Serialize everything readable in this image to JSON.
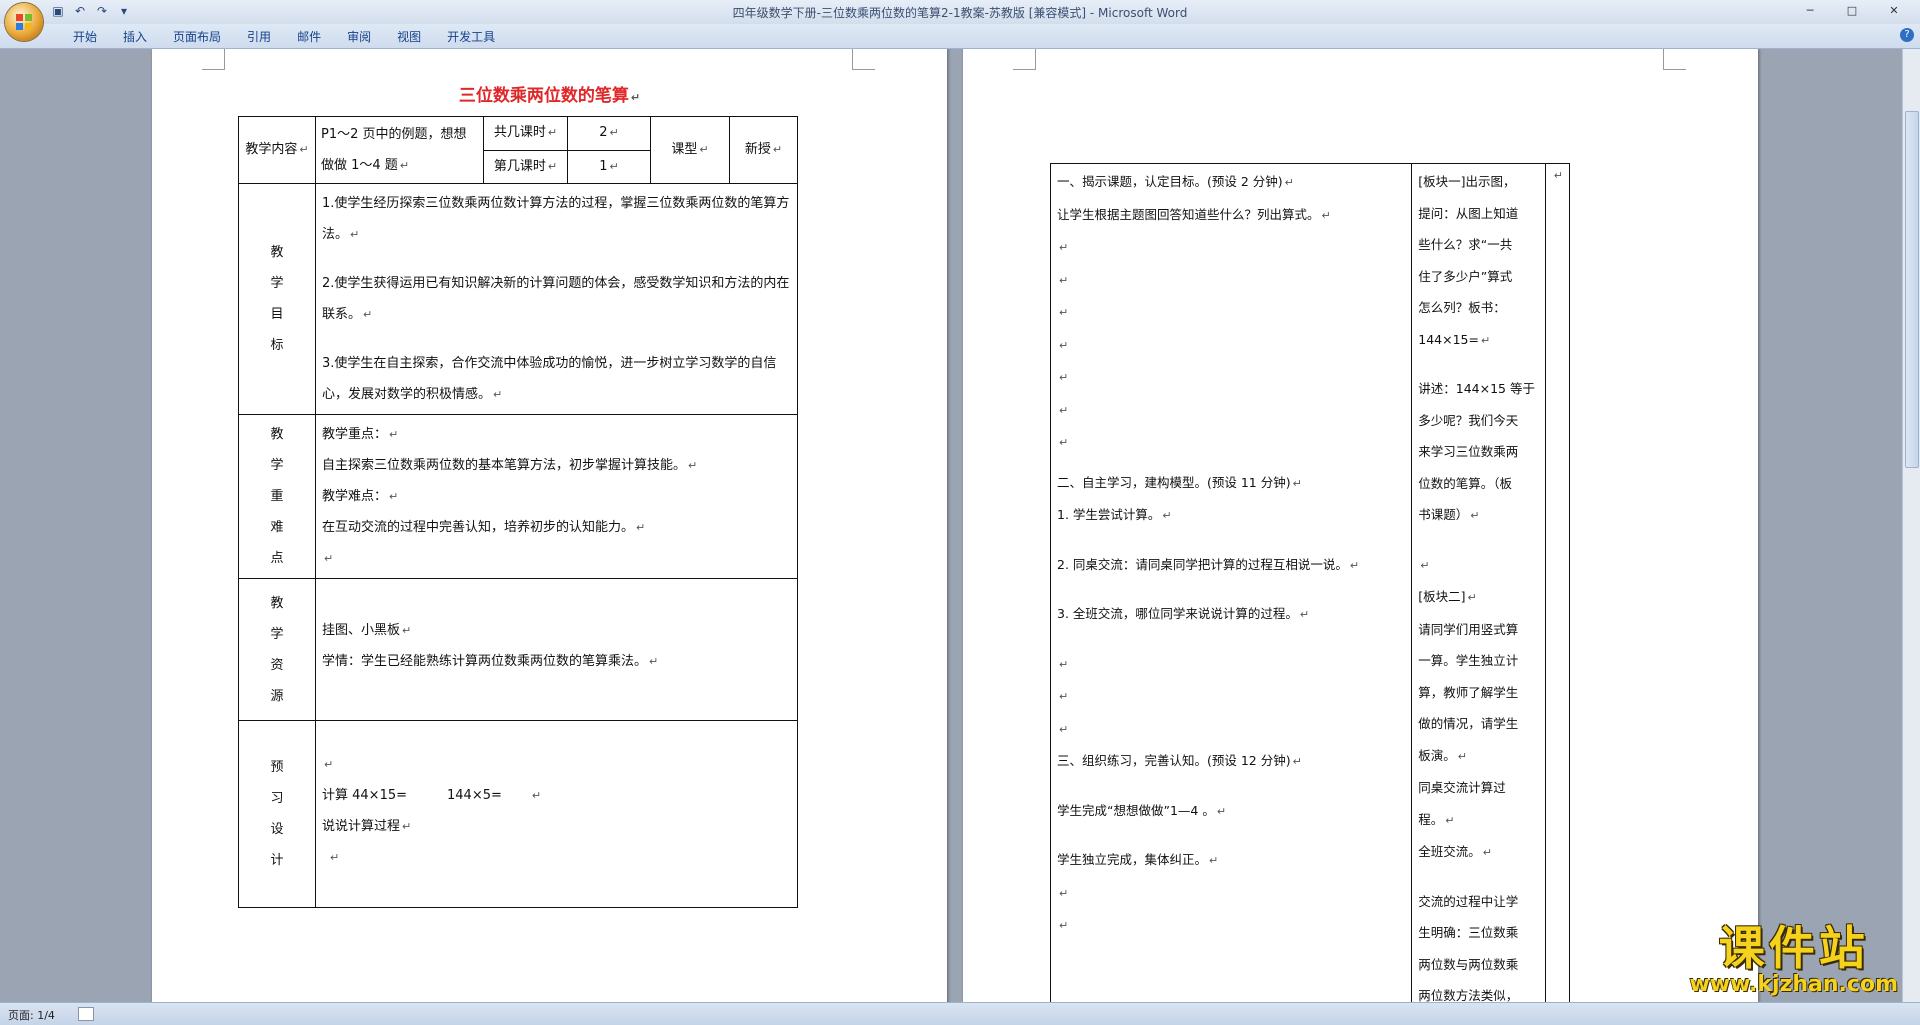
{
  "window": {
    "title": "四年级数学下册-三位数乘两位数的笔算2-1教案-苏教版 [兼容模式] - Microsoft Word"
  },
  "ribbon": {
    "tabs": [
      "开始",
      "插入",
      "页面布局",
      "引用",
      "邮件",
      "审阅",
      "视图",
      "开发工具"
    ]
  },
  "page1": {
    "heading": "三位数乘两位数的笔算",
    "header_row": {
      "label": "教学内容",
      "content_line1": "P1～2 页中的例题，想想",
      "content_line2": "做做 1～4 题",
      "total_label": "共几课时",
      "total_value": "2",
      "which_label": "第几课时",
      "which_value": "1",
      "type_label": "课型",
      "type_value": "新授"
    },
    "goals": {
      "label_chars": [
        "教",
        "学",
        "目",
        "标"
      ],
      "items": [
        "1.使学生经历探索三位数乘两位数计算方法的过程，掌握三位数乘两位数的笔算方法。",
        "2.使学生获得运用已有知识解决新的计算问题的体会，感受数学知识和方法的内在联系。",
        "3.使学生在自主探索，合作交流中体验成功的愉悦，进一步树立学习数学的自信心，发展对数学的积极情感。"
      ]
    },
    "keypoints": {
      "label_chars": [
        "教",
        "学",
        "重",
        "难",
        "点"
      ],
      "lines": [
        "教学重点：",
        "自主探索三位数乘两位数的基本笔算方法，初步掌握计算技能。",
        "教学难点：",
        "在互动交流的过程中完善认知，培养初步的认知能力。"
      ]
    },
    "resources": {
      "label_chars": [
        "教",
        "学",
        "资",
        "源"
      ],
      "lines": [
        "挂图、小黑板",
        "学情：学生已经能熟练计算两位数乘两位数的笔算乘法。"
      ]
    },
    "preview": {
      "label_chars": [
        "预",
        "习",
        "设",
        "计"
      ],
      "calc_a": "计算 44×15=",
      "calc_b": "144×5=",
      "line2": "说说计算过程"
    }
  },
  "page2": {
    "left_column": [
      "一、揭示课题，认定目标。(预设 2 分钟)",
      "让学生根据主题图回答知道些什么？列出算式。",
      "二、自主学习，建构模型。(预设 11 分钟)",
      "1. 学生尝试计算。",
      "2. 同桌交流：请同桌同学把计算的过程互相说一说。",
      "3. 全班交流，哪位同学来说说计算的过程。",
      "三、组织练习，完善认知。(预设 12 分钟)",
      "学生完成“想想做做”1—4 。",
      "学生独立完成，集体纠正。"
    ],
    "right_column": [
      "[板块一]出示图，",
      "提问：从图上知道",
      "些什么？求“一共",
      "住了多少户”算式",
      "怎么列？板书：",
      "144×15=",
      "讲述：144×15 等于",
      "多少呢？我们今天",
      "来学习三位数乘两",
      "位数的笔算。（板",
      "书课题）",
      "[板块二]",
      "请同学们用竖式算",
      "一算。学生独立计",
      "算，教师了解学生",
      "做的情况，请学生",
      "板演。",
      "同桌交流计算过",
      "程。",
      "全班交流。",
      "交流的过程中让学",
      "生明确：三位数乘",
      "两位数与两位数乘",
      "两位数方法类似，"
    ]
  },
  "statusbar": {
    "page_info": "页面: 1/4"
  },
  "watermark": {
    "text": "课件站",
    "url": "www.kjzhan.com"
  },
  "icons": {
    "office_button": "office-logo-icon",
    "save": "save-icon",
    "undo": "undo-icon",
    "redo": "redo-icon",
    "help": "help-icon"
  }
}
